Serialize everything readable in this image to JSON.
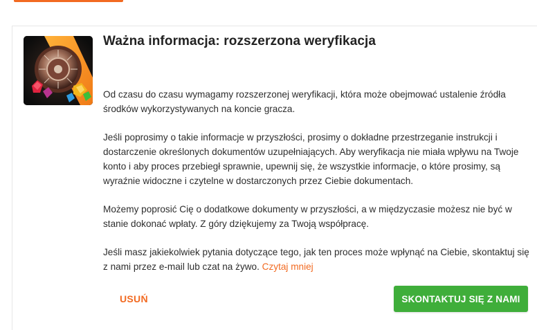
{
  "notice": {
    "title": "Ważna informacja: rozszerzona weryfikacja",
    "paragraphs": [
      "Od czasu do czasu wymagamy rozszerzonej weryfikacji, która może obejmować ustalenie źródła środków wykorzystywanych na koncie gracza.",
      "Jeśli poprosimy o takie informacje w przyszłości, prosimy o dokładne przestrzeganie instrukcji i dostarczenie określonych dokumentów uzupełniających. Aby weryfikacja nie miała wpływu na Twoje konto i aby proces przebiegł sprawnie, upewnij się, że wszystkie informacje, o które prosimy, są wyraźnie widoczne i czytelne w dostarczonych przez Ciebie dokumentach.",
      "Możemy poprosić Cię o dodatkowe dokumenty w przyszłości, a w międzyczasie możesz nie być w stanie dokonać wpłaty. Z góry dziękujemy za Twoją współpracę."
    ],
    "last_paragraph": "Jeśli masz jakiekolwiek pytania dotyczące tego, jak ten proces może wpłynąć na Ciebie, skontaktuj się z nami przez e-mail lub czat na żywo.",
    "read_more_link": "Czytaj mniej",
    "image_icon": "roulette-wheel-gems-icon"
  },
  "actions": {
    "remove_label": "USUŃ",
    "contact_label": "SKONTAKTUJ SIĘ Z NAMI"
  },
  "colors": {
    "accent": "#f26a21",
    "primary_button": "#3fae3a"
  }
}
